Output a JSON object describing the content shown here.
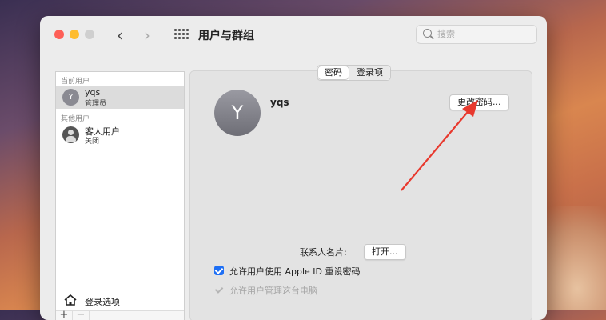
{
  "window": {
    "title": "用户与群组"
  },
  "search": {
    "placeholder": "搜索"
  },
  "sidebar": {
    "current_users_label": "当前用户",
    "other_users_label": "其他用户",
    "current_user": {
      "initial": "Y",
      "name": "yqs",
      "role": "管理员"
    },
    "guest_user": {
      "name": "客人用户",
      "status": "关闭"
    },
    "login_options_label": "登录选项",
    "add_label": "+",
    "remove_label": "−"
  },
  "tabs": [
    {
      "label": "密码",
      "active": true
    },
    {
      "label": "登录项",
      "active": false
    }
  ],
  "main": {
    "avatar_initial": "Y",
    "user_name": "yqs",
    "change_password_label": "更改密码...",
    "contact_card_label": "联系人名片:",
    "open_button_label": "打开...",
    "allow_apple_id_reset_label": "允许用户使用 Apple ID 重设密码",
    "allow_apple_id_reset_checked": true,
    "allow_admin_label": "允许用户管理这台电脑",
    "allow_admin_checked": true,
    "allow_admin_enabled": false
  },
  "colors": {
    "accent": "#1e6ff5",
    "annotation_arrow": "#e8392e",
    "close": "#fe5f57",
    "minimize": "#febc2e"
  }
}
